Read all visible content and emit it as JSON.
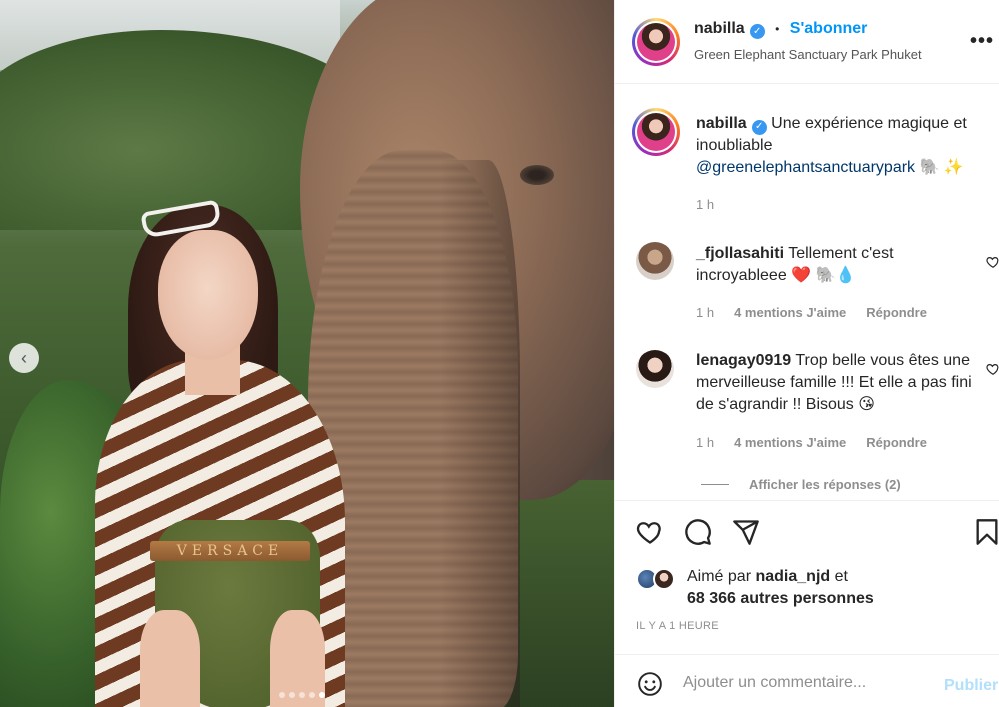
{
  "post": {
    "carousel": {
      "dot_count": 5,
      "active_index": 4,
      "belt_text": "VERSACE"
    }
  },
  "header": {
    "username": "nabilla",
    "separator": "•",
    "follow_label": "S'abonner",
    "location": "Green Elephant Sanctuary Park Phuket",
    "more_label": "•••"
  },
  "caption": {
    "username": "nabilla",
    "text": "Une expérience magique et inoubliable",
    "mention": "@greenelephantsanctuarypark",
    "emojis": "🐘 ✨",
    "time": "1 h"
  },
  "comments": [
    {
      "username": "_fjollasahiti",
      "text": "Tellement c'est incroyableee",
      "emojis": "❤️ 🐘💧",
      "time": "1 h",
      "likes": "4 mentions J'aime",
      "reply": "Répondre"
    },
    {
      "username": "lenagay0919",
      "text": "Trop belle vous êtes une merveilleuse famille !!! Et elle a pas fini de s'agrandir !! Bisous",
      "emojis": "😘",
      "time": "1 h",
      "likes": "4 mentions J'aime",
      "reply": "Répondre"
    }
  ],
  "replies_label": "Afficher les réponses (2)",
  "likes": {
    "prefix": "Aimé par",
    "user": "nadia_njd",
    "connector": "et",
    "others": "68 366 autres personnes"
  },
  "timestamp": "IL Y A 1 HEURE",
  "add_comment": {
    "placeholder": "Ajouter un commentaire...",
    "post_label": "Publier"
  },
  "colors": {
    "accent": "#0095f6",
    "verified": "#3897f0",
    "post_disabled": "#b2dffc",
    "muted": "#8e8e8e",
    "heart": "#ed4956"
  },
  "icons": [
    "chevron-left-icon",
    "more-icon",
    "verified-icon",
    "heart-icon",
    "comment-icon",
    "share-icon",
    "bookmark-icon",
    "emoji-icon"
  ]
}
